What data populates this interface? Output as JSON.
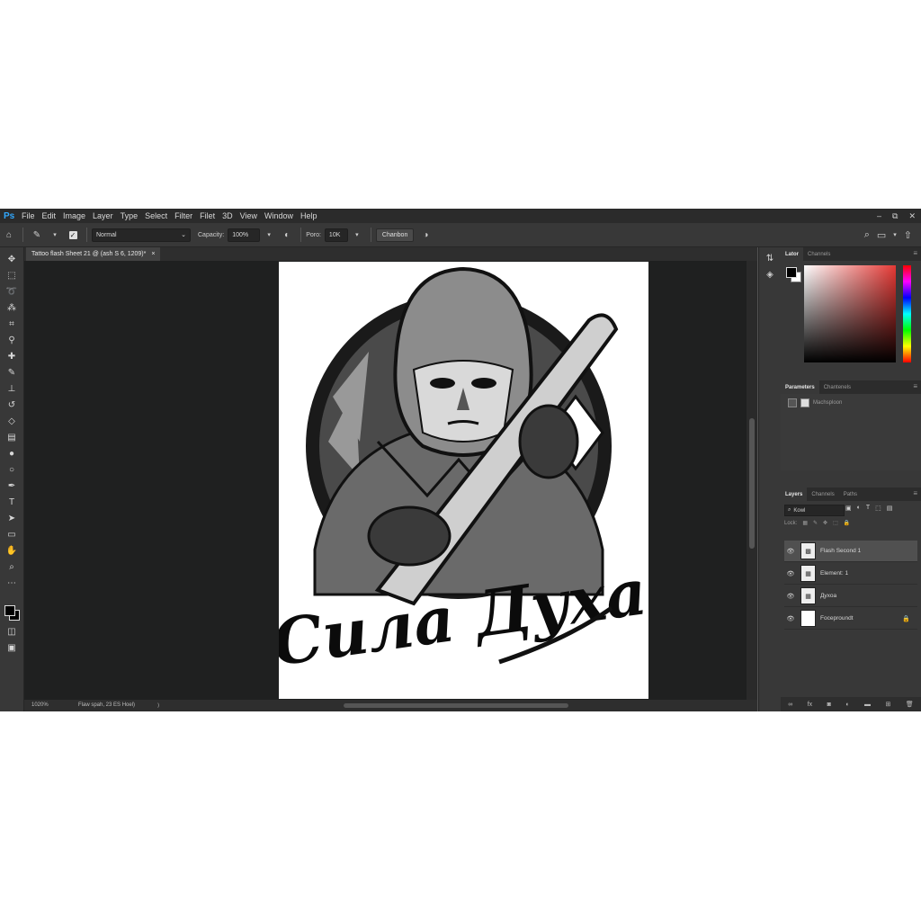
{
  "app": {
    "logo": "Ps",
    "menu": [
      "File",
      "Edit",
      "Image",
      "Layer",
      "Type",
      "Select",
      "Filter",
      "Filet",
      "3D",
      "View",
      "Window",
      "Help"
    ],
    "window_controls": [
      "–",
      "⧉",
      "✕"
    ]
  },
  "options": {
    "blend_mode": "Normal",
    "capacity_label": "Capacity:",
    "capacity_value": "100%",
    "poro_label": "Poro:",
    "poro_value": "10K",
    "button_label": "Chanbon",
    "dropdown_glyph": "⌄"
  },
  "document": {
    "tab_title": "Tattoo flash Sheet 21 @ (ash S 6, 1209)*",
    "close_glyph": "×",
    "zoom": "1020%",
    "status": "Flaw spah, 23 ES Hoel)",
    "status_arrow": "⟩",
    "art_title": "Сила Духа"
  },
  "panels": {
    "color": {
      "tabs": [
        "Lator",
        "Channels"
      ]
    },
    "parameters": {
      "tabs": [
        "Parameters",
        "Chantenels"
      ],
      "row_label": "Machsploon"
    },
    "layers": {
      "tabs": [
        "Layers",
        "Channels",
        "Paths"
      ],
      "filter_label": "Kowl",
      "lock_label": "Lock:",
      "items": [
        {
          "name": "Flash Second 1"
        },
        {
          "name": "Element: 1"
        },
        {
          "name": "Дyxoa"
        },
        {
          "name": "Foceproundt"
        }
      ]
    }
  },
  "colors": {
    "accent": "#31a8ff",
    "panel_bg": "#383838",
    "canvas_bg": "#1f2020",
    "foreground": "#000000",
    "background": "#ffffff"
  }
}
